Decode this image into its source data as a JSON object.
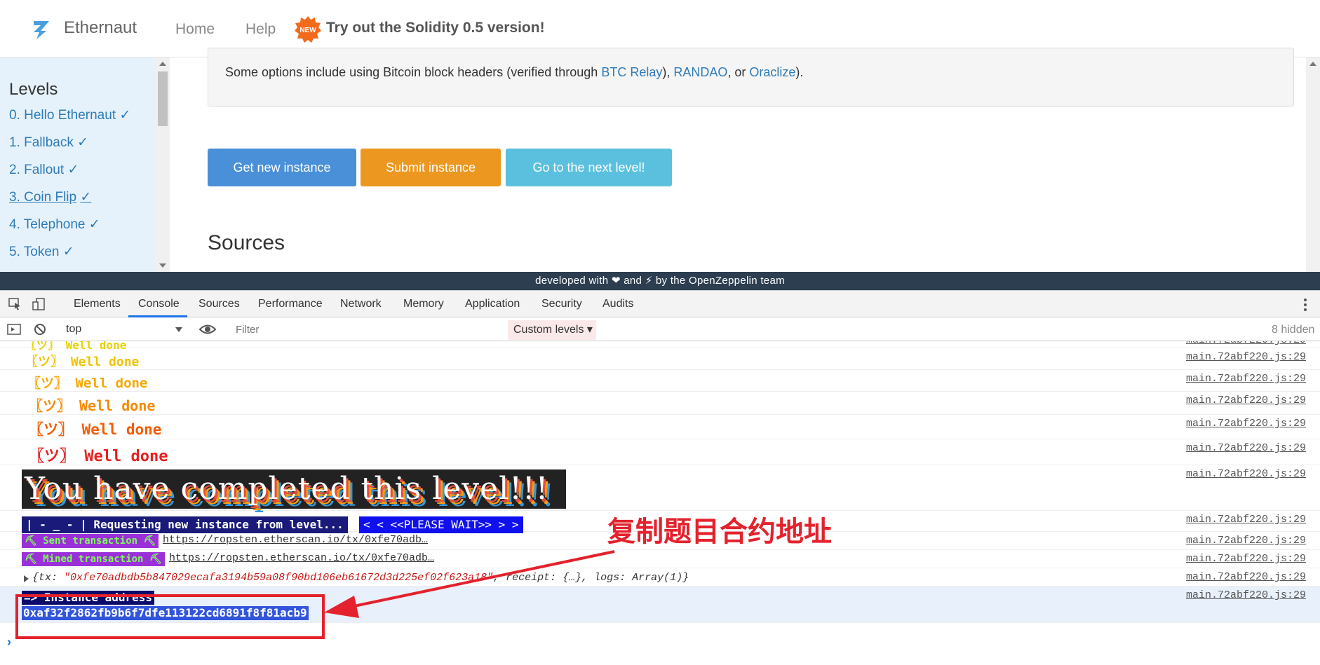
{
  "navbar": {
    "logo_text": "Ethernaut",
    "home": "Home",
    "help": "Help",
    "badge": "NEW",
    "promo": "Try out the Solidity 0.5 version!"
  },
  "sidebar": {
    "title": "Levels",
    "items": [
      {
        "label": "0. Hello Ethernaut",
        "check": "✓"
      },
      {
        "label": "1. Fallback",
        "check": "✓"
      },
      {
        "label": "2. Fallout",
        "check": "✓"
      },
      {
        "label": "3. Coin Flip",
        "check": "✓"
      },
      {
        "label": "4. Telephone",
        "check": "✓"
      },
      {
        "label": "5. Token",
        "check": "✓"
      }
    ]
  },
  "info": {
    "prefix": "Some options include using Bitcoin block headers (verified through ",
    "link1": "BTC Relay",
    "sep1": "), ",
    "link2": "RANDAO",
    "sep2": ", or ",
    "link3": "Oraclize",
    "suffix": ")."
  },
  "buttons": {
    "new_instance": "Get new instance",
    "submit_instance": "Submit instance",
    "next_level": "Go to the next level!"
  },
  "sources_title": "Sources",
  "footer": {
    "text_a": "developed with",
    "text_b": "and",
    "text_c": "by the OpenZeppelin team"
  },
  "devtools": {
    "tabs": [
      "Elements",
      "Console",
      "Sources",
      "Performance",
      "Network",
      "Memory",
      "Application",
      "Security",
      "Audits"
    ],
    "context": "top",
    "filter_placeholder": "Filter",
    "custom_levels": "Custom levels ▾",
    "hidden": "8 hidden"
  },
  "console": {
    "source": "main.72abf220.js:29",
    "welldone": [
      {
        "text": "〖ツ〗 Well done",
        "color": "#e6d200"
      },
      {
        "text": "〖ツ〗 Well done",
        "color": "#f2c400"
      },
      {
        "text": "〖ツ〗 Well done",
        "color": "#f5a800"
      },
      {
        "text": "〖ツ〗 Well done",
        "color": "#f58a00"
      },
      {
        "text": "〖ツ〗 Well done",
        "color": "#f55c00"
      },
      {
        "text": "〖ツ〗 Well done",
        "color": "#e82020"
      }
    ],
    "completed": "You have completed this level!!!",
    "request_left": "| - _ - | Requesting new instance from level...",
    "request_right": "< < <<PLEASE WAIT>> > >",
    "sent_label": "⛏ Sent transaction ⛏",
    "sent_link": "https://ropsten.etherscan.io/tx/0xfe70adb…",
    "mined_label": "⛏ Mined transaction ⛏",
    "mined_link": "https://ropsten.etherscan.io/tx/0xfe70adb…",
    "obj_a": "{tx: ",
    "obj_tx": "\"0xfe70adbdb5b847029ecafa3194b59a08f90bd106eb61672d3d225ef02f623a18\"",
    "obj_b": ", receipt: {…}, logs: Array(1)}",
    "instance_label": "=> Instance address",
    "instance_address": "0xaf32f2862fb9b6f7dfe113122cd6891f8f81acb9"
  },
  "annotation": {
    "text": "复制题目合约地址",
    "color": "#e3222d"
  }
}
